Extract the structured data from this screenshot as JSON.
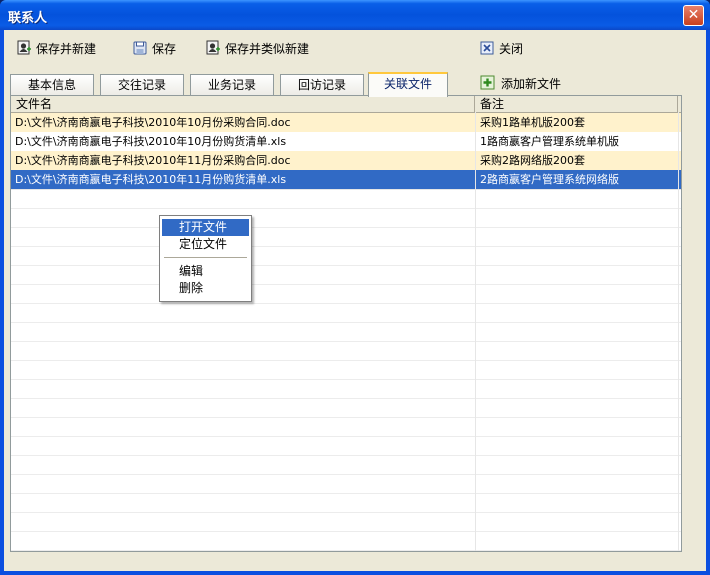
{
  "window": {
    "title": "联系人",
    "close_glyph": "✕"
  },
  "toolbar": {
    "save_new": "保存并新建",
    "save": "保存",
    "save_similar_new": "保存并类似新建",
    "close": "关闭"
  },
  "tabs": [
    "基本信息",
    "交往记录",
    "业务记录",
    "回访记录",
    "关联文件"
  ],
  "active_tab": "关联文件",
  "add_file": "添加新文件",
  "table": {
    "headers": [
      "文件名",
      "备注"
    ],
    "rows": [
      {
        "file": "D:\\文件\\济南商嬴电子科技\\2010年10月份采购合同.doc",
        "note": "采购1路单机版200套"
      },
      {
        "file": "D:\\文件\\济南商嬴电子科技\\2010年10月份购货清单.xls",
        "note": "1路商嬴客户管理系统单机版"
      },
      {
        "file": "D:\\文件\\济南商嬴电子科技\\2010年11月份采购合同.doc",
        "note": "采购2路网络版200套"
      },
      {
        "file": "D:\\文件\\济南商嬴电子科技\\2010年11月份购货清单.xls",
        "note": "2路商嬴客户管理系统网络版"
      }
    ]
  },
  "context_menu": [
    "打开文件",
    "定位文件",
    "编辑",
    "删除"
  ],
  "colors": {
    "stripe": "#fff2cc",
    "selected": "#316ac5",
    "titlebar": "#0a5fe8"
  }
}
